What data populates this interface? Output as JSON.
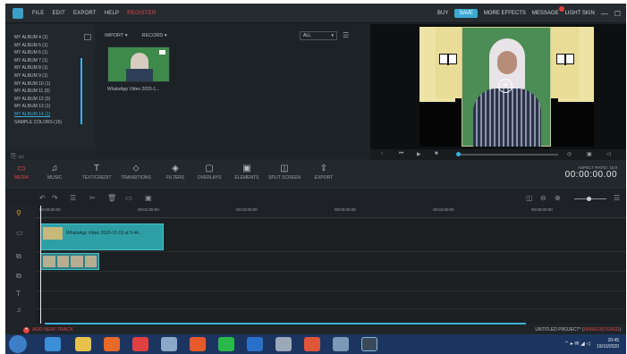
{
  "menu": {
    "items": [
      "FILE",
      "EDIT",
      "EXPORT",
      "HELP"
    ],
    "register": "REGISTER"
  },
  "topbar": {
    "buy": "BUY",
    "save": "SAVE",
    "more_effects": "MORE EFFECTS",
    "message": "MESSAGE",
    "skin": "LIGHT SKIN"
  },
  "albums": {
    "items": [
      "MY ALBUM 4 (1)",
      "MY ALBUM 5 (1)",
      "MY ALBUM 6 (1)",
      "MY ALBUM 7 (1)",
      "MY ALBUM 8 (1)",
      "MY ALBUM 9 (1)",
      "MY ALBUM 10 (1)",
      "MY ALBUM 11 (0)",
      "MY ALBUM 12 (0)",
      "MY ALBUM 13 (1)",
      "MY ALBUM 14 (1)",
      "SAMPLE COLORS (15)"
    ],
    "active_index": 10
  },
  "library": {
    "import": "IMPORT",
    "record": "RECORD",
    "filter": "ALL",
    "clip_caption": "WhatsApp Video 2020-1..."
  },
  "tools": [
    "MEDIA",
    "MUSIC",
    "TEXT/CREDIT",
    "TRANSITIONS",
    "FILTERS",
    "OVERLAYS",
    "ELEMENTS",
    "SPLIT SCREEN",
    "EXPORT"
  ],
  "tool_icons": [
    "folder-icon",
    "music-icon",
    "text-icon",
    "transitions-icon",
    "filters-icon",
    "overlays-icon",
    "elements-icon",
    "split-screen-icon",
    "export-icon"
  ],
  "preview": {
    "aspect_label": "ASPECT RATIO: 16:9",
    "timecode": "00:00:00.00"
  },
  "ruler_ticks": [
    "00:00:00:00",
    "00:01:00:00",
    "00:02:00:00",
    "00:03:00:00",
    "00:04:00:00",
    "00:05:00:00"
  ],
  "timeline": {
    "clip_name": "WhatsApp Video 2020-10-19 at 9.44..."
  },
  "footer": {
    "add_track": "ADD NEW TRACK",
    "project": "UNTITLED PROJECT",
    "unregistered": "UNREGISTERED"
  },
  "taskbar": {
    "time": "20:45",
    "date": "19/10/2020"
  },
  "colors": {
    "accent": "#3AA9D4",
    "red": "#E04444",
    "bg": "#1F2428"
  }
}
